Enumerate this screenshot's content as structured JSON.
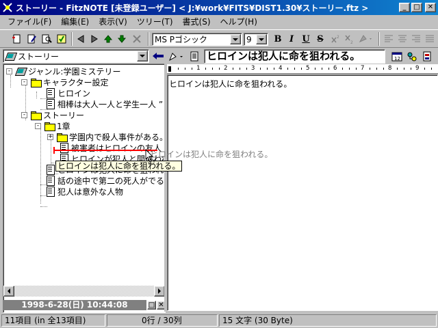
{
  "window": {
    "title": "ストーリー - FitzNOTE [未登録ユーザー] < J:¥work¥FITS¥DIST1.30¥ストーリー.ftz >",
    "minimize": "_",
    "maximize": "□",
    "close": "✕"
  },
  "menu": [
    "ファイル(F)",
    "編集(E)",
    "表示(V)",
    "ツリー(T)",
    "書式(S)",
    "ヘルプ(H)"
  ],
  "toolbar": {
    "font_name": "MS Pゴシック",
    "font_size": "9",
    "bold": "B",
    "italic": "I",
    "underline": "U",
    "strike": "S"
  },
  "node_combo": {
    "value": "ストーリー"
  },
  "tree": {
    "root": "ジャンル:学園ミステリー",
    "items": [
      {
        "label": "キャラクター設定",
        "type": "folder",
        "level": 1,
        "expanded": true
      },
      {
        "label": "ヒロイン",
        "type": "doc",
        "level": 2
      },
      {
        "label": "相棒は大人一人と学生一人 ”",
        "type": "doc",
        "level": 2
      },
      {
        "label": "ストーリー",
        "type": "folder",
        "level": 1,
        "expanded": true
      },
      {
        "label": "1章",
        "type": "folder",
        "level": 2,
        "expanded": true
      },
      {
        "label": "学園内で殺人事件がある。",
        "type": "folder",
        "level": 3,
        "expanded": false
      },
      {
        "label": "被害者はヒロインの友人",
        "type": "doc",
        "level": 3
      },
      {
        "label": "ヒロインが犯人と間違われる",
        "type": "doc",
        "level": 3
      },
      {
        "label": "ヒロインは犯人に命を狙われる。",
        "type": "doc",
        "level": 2
      },
      {
        "label": "話の途中で第二の死人がでる",
        "type": "doc",
        "level": 2
      },
      {
        "label": "犯人は意外な人物",
        "type": "doc",
        "level": 2
      }
    ]
  },
  "drag": {
    "tooltip": "ヒロインは犯人に命を狙われる。",
    "ghost": "ヒロインは犯人に命を狙われる。"
  },
  "datebar": {
    "text": "1998-6-28(日) 10:44:08",
    "restore": "□",
    "close": "✕"
  },
  "document": {
    "title": "ヒロインは犯人に命を狙われる。",
    "body": "ヒロインは犯人に命を狙われる。"
  },
  "ruler": {
    "numbers": [
      "1",
      "2",
      "3",
      "4",
      "5",
      "6",
      "7",
      "8",
      "9",
      "1"
    ]
  },
  "status": {
    "items": "11項目 (in 全13項目)",
    "position": "0行 / 30列",
    "chars": "15 文字 (30 Byte)"
  },
  "colors": {
    "title_bar_start": "#000080",
    "title_bar_end": "#1084d0",
    "face": "#c0c0c0",
    "drop_marker": "#ff0000",
    "tooltip_bg": "#ffffe1"
  }
}
